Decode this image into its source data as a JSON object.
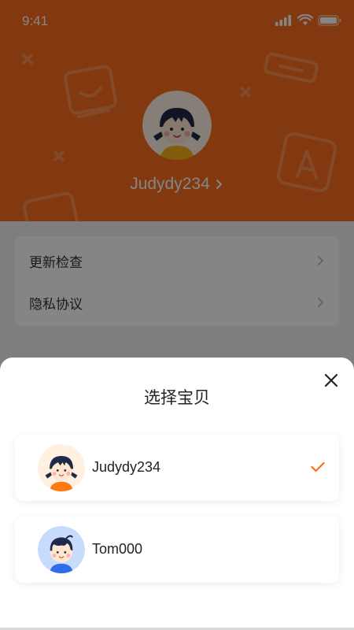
{
  "status_bar": {
    "time": "9:41"
  },
  "profile": {
    "name": "Judydy234"
  },
  "settings": {
    "items": [
      {
        "label": "更新检查"
      },
      {
        "label": "隐私协议"
      }
    ]
  },
  "sheet": {
    "title": "选择宝贝",
    "children": [
      {
        "name": "Judydy234",
        "selected": true
      },
      {
        "name": "Tom000",
        "selected": false
      }
    ]
  },
  "colors": {
    "brand": "#fa6e1e",
    "check": "#fa6e1e",
    "overlay": "rgba(0,0,0,0.48)"
  }
}
